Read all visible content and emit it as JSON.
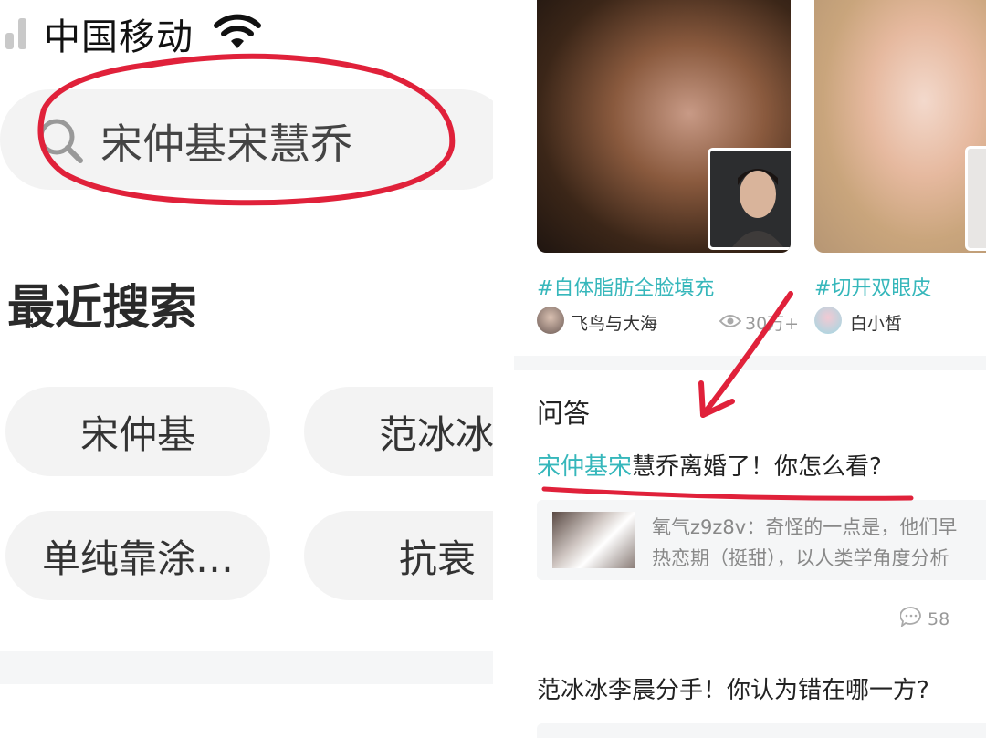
{
  "status_bar": {
    "carrier": "中国移动"
  },
  "search": {
    "query": "宋仲基宋慧乔"
  },
  "recent": {
    "title": "最近搜索",
    "chips": [
      "宋仲基",
      "范冰冰",
      "单纯靠涂…",
      "抗衰"
    ]
  },
  "feed": {
    "cards": [
      {
        "tag": "#自体脂肪全脸填充",
        "author": "飞鸟与大海",
        "views": "30万+"
      },
      {
        "tag": "#切开双眼皮",
        "author": "白小皙"
      }
    ]
  },
  "qa": {
    "label": "问答",
    "questions": [
      {
        "title_highlight": "宋仲基宋",
        "title_rest": "慧乔离婚了！你怎么看?",
        "answer_line1": "氧气z9z8v：奇怪的一点是，他们早",
        "answer_line2": "热恋期（挺甜），以人类学角度分析",
        "comment_count": "58"
      },
      {
        "title": "范冰冰李晨分手！你认为错在哪一方?"
      }
    ]
  },
  "colors": {
    "accent": "#36b7bb",
    "annotation": "#e0213a",
    "chip_bg": "#f3f3f3"
  }
}
